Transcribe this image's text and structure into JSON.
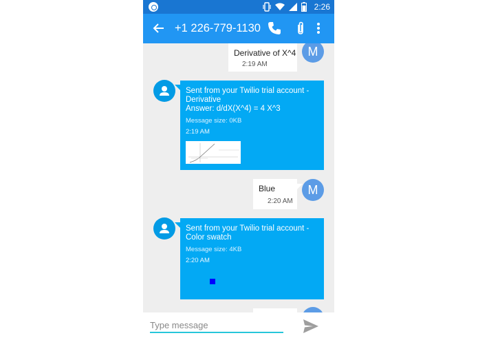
{
  "status_bar": {
    "time": "2:26"
  },
  "toolbar": {
    "title": "+1 226-779-1130"
  },
  "messages": {
    "out1": {
      "text": "Derivative of X^4",
      "time": "2:19 AM",
      "avatar_letter": "M"
    },
    "in1": {
      "text_line1": "Sent from your Twilio trial account -",
      "text_line2": "Derivative",
      "text_line3": "Answer: d/dX(X^4) = 4 X^3",
      "size": "Message size: 0KB",
      "time": "2:19 AM"
    },
    "out2": {
      "text": "Blue",
      "time": "2:20 AM",
      "avatar_letter": "M"
    },
    "in2": {
      "text_line1": "Sent from your Twilio trial account -",
      "text_line2": "Color swatch",
      "size": "Message size: 4KB",
      "time": "2:20 AM",
      "swatch_color": "#0000ff"
    }
  },
  "composer": {
    "placeholder": "Type message"
  },
  "colors": {
    "status_bar": "#1976d2",
    "toolbar": "#2196f3",
    "incoming_bubble": "#03a9f4",
    "avatar_out": "#5c9ce6",
    "input_underline": "#26c6da"
  }
}
